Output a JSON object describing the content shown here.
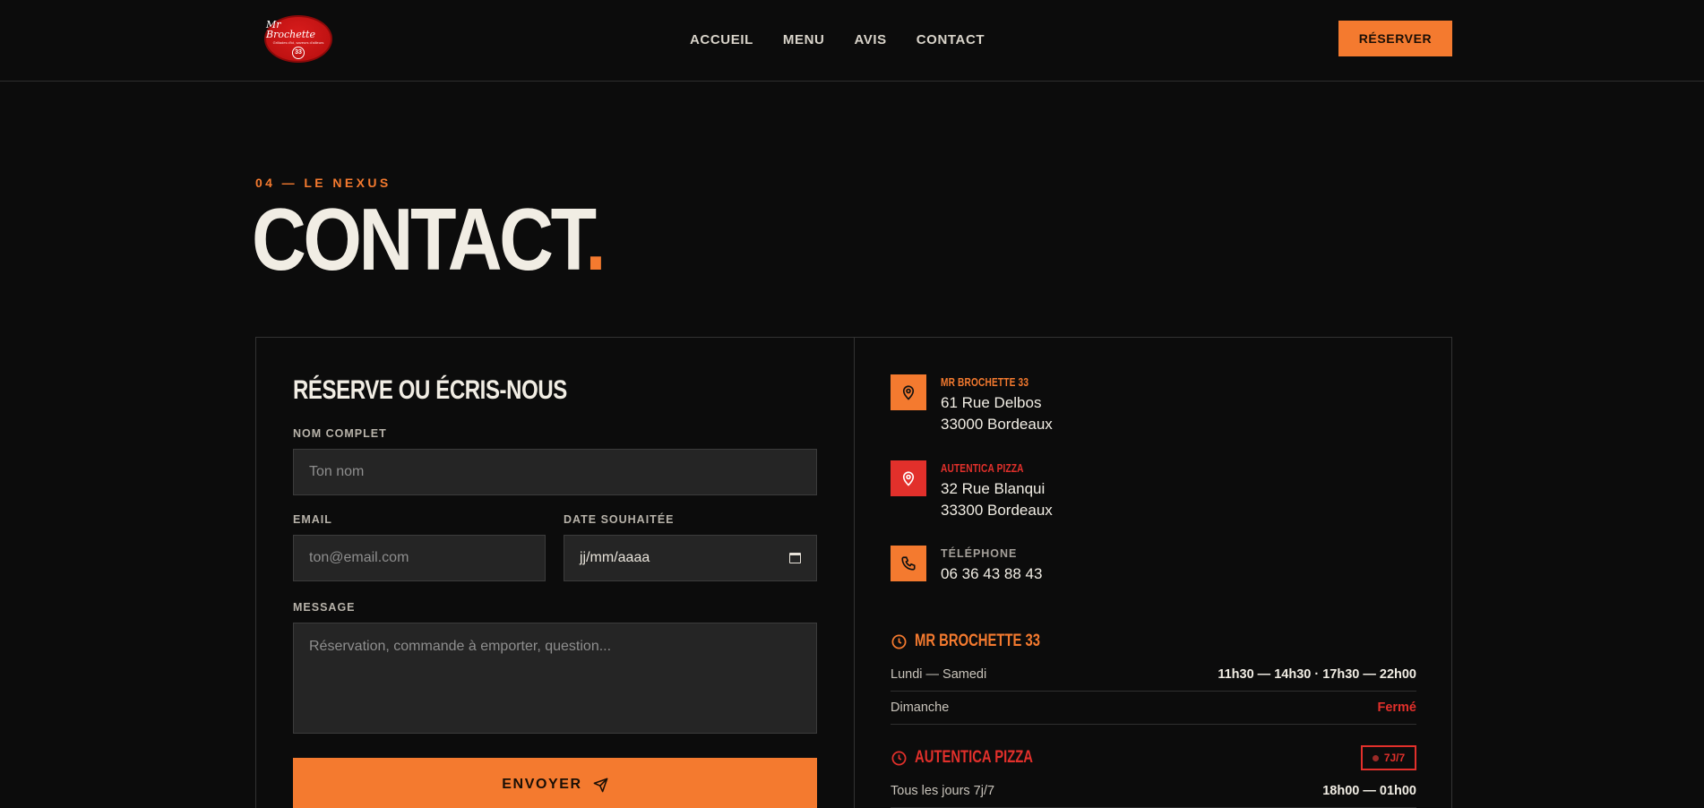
{
  "header": {
    "logo": {
      "script": "Mr Brochette",
      "tagline": "Grillades d'ici, saveurs d'ailleurs",
      "number": "33"
    },
    "nav": [
      {
        "label": "ACCUEIL"
      },
      {
        "label": "MENU"
      },
      {
        "label": "AVIS"
      },
      {
        "label": "CONTACT"
      }
    ],
    "reserve_label": "RÉSERVER"
  },
  "hero": {
    "kicker": "04 — LE NEXUS",
    "title": "CONTACT",
    "title_dot": "."
  },
  "form": {
    "title": "RÉSERVE OU ÉCRIS-NOUS",
    "name_label": "NOM COMPLET",
    "name_placeholder": "Ton nom",
    "email_label": "EMAIL",
    "email_placeholder": "ton@email.com",
    "date_label": "DATE SOUHAITÉE",
    "date_value": "jj/mm/aaaa",
    "message_label": "MESSAGE",
    "message_placeholder": "Réservation, commande à emporter, question...",
    "submit_label": "ENVOYER"
  },
  "info": {
    "locations": [
      {
        "name": "MR BROCHETTE 33",
        "line1": "61 Rue Delbos",
        "line2": "33000 Bordeaux",
        "icon": "map-pin-icon",
        "color": "#f47a2f"
      },
      {
        "name": "AUTENTICA PIZZA",
        "line1": "32 Rue Blanqui",
        "line2": "33300 Bordeaux",
        "icon": "map-pin-icon",
        "color": "#e2302b"
      }
    ],
    "phone": {
      "label": "TÉLÉPHONE",
      "value": "06 36 43 88 43",
      "icon": "phone-icon"
    }
  },
  "hours": {
    "brochette": {
      "title": "MR BROCHETTE 33",
      "rows": [
        {
          "day": "Lundi — Samedi",
          "time": "11h30 — 14h30 · 17h30 — 22h00"
        },
        {
          "day": "Dimanche",
          "time": "Fermé"
        }
      ]
    },
    "pizza": {
      "title": "AUTENTICA PIZZA",
      "badge": "7J/7",
      "rows": [
        {
          "day": "Tous les jours 7j/7",
          "time": "18h00 — 01h00"
        }
      ]
    }
  },
  "colors": {
    "accent": "#f47a2f",
    "red": "#e2302b",
    "background": "#0c0c0c",
    "field": "#252525"
  }
}
